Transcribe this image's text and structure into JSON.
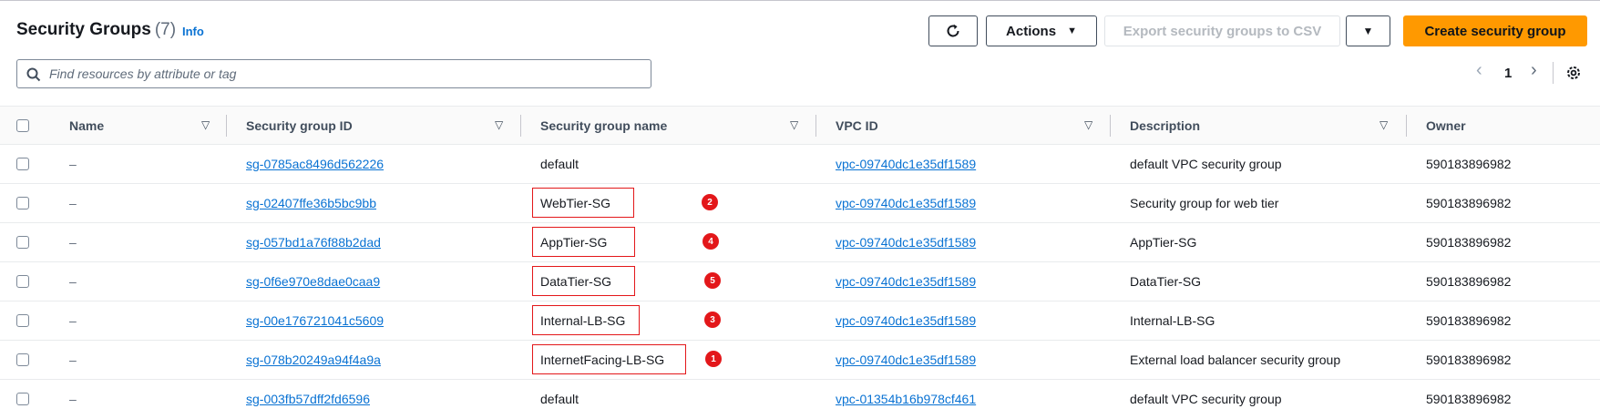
{
  "header": {
    "title": "Security Groups",
    "count": "(7)",
    "info_label": "Info"
  },
  "toolbar": {
    "refresh_icon": "refresh-icon",
    "actions_label": "Actions",
    "export_label": "Export security groups to CSV",
    "create_label": "Create security group"
  },
  "search": {
    "placeholder": "Find resources by attribute or tag"
  },
  "pagination": {
    "current_page": "1"
  },
  "table": {
    "columns": [
      "Name",
      "Security group ID",
      "Security group name",
      "VPC ID",
      "Description",
      "Owner"
    ],
    "rows": [
      {
        "name": "–",
        "sg_id": "sg-0785ac8496d562226",
        "sg_name": "default",
        "vpc_id": "vpc-09740dc1e35df1589",
        "description": "default VPC security group",
        "owner": "590183896982",
        "annotation": ""
      },
      {
        "name": "–",
        "sg_id": "sg-02407ffe36b5bc9bb",
        "sg_name": "WebTier-SG",
        "vpc_id": "vpc-09740dc1e35df1589",
        "description": "Security group for web tier",
        "owner": "590183896982",
        "annotation": "2"
      },
      {
        "name": "–",
        "sg_id": "sg-057bd1a76f88b2dad",
        "sg_name": "AppTier-SG",
        "vpc_id": "vpc-09740dc1e35df1589",
        "description": "AppTier-SG",
        "owner": "590183896982",
        "annotation": "4"
      },
      {
        "name": "–",
        "sg_id": "sg-0f6e970e8dae0caa9",
        "sg_name": "DataTier-SG",
        "vpc_id": "vpc-09740dc1e35df1589",
        "description": "DataTier-SG",
        "owner": "590183896982",
        "annotation": "5"
      },
      {
        "name": "–",
        "sg_id": "sg-00e176721041c5609",
        "sg_name": "Internal-LB-SG",
        "vpc_id": "vpc-09740dc1e35df1589",
        "description": "Internal-LB-SG",
        "owner": "590183896982",
        "annotation": "3"
      },
      {
        "name": "–",
        "sg_id": "sg-078b20249a94f4a9a",
        "sg_name": "InternetFacing-LB-SG",
        "vpc_id": "vpc-09740dc1e35df1589",
        "description": "External load balancer security group",
        "owner": "590183896982",
        "annotation": "1"
      },
      {
        "name": "–",
        "sg_id": "sg-003fb57dff2fd6596",
        "sg_name": "default",
        "vpc_id": "vpc-01354b16b978cf461",
        "description": "default VPC security group",
        "owner": "590183896982",
        "annotation": ""
      }
    ]
  },
  "colors": {
    "primary_button": "#ff9900",
    "link": "#0972d3",
    "annotation": "#e3171a"
  }
}
